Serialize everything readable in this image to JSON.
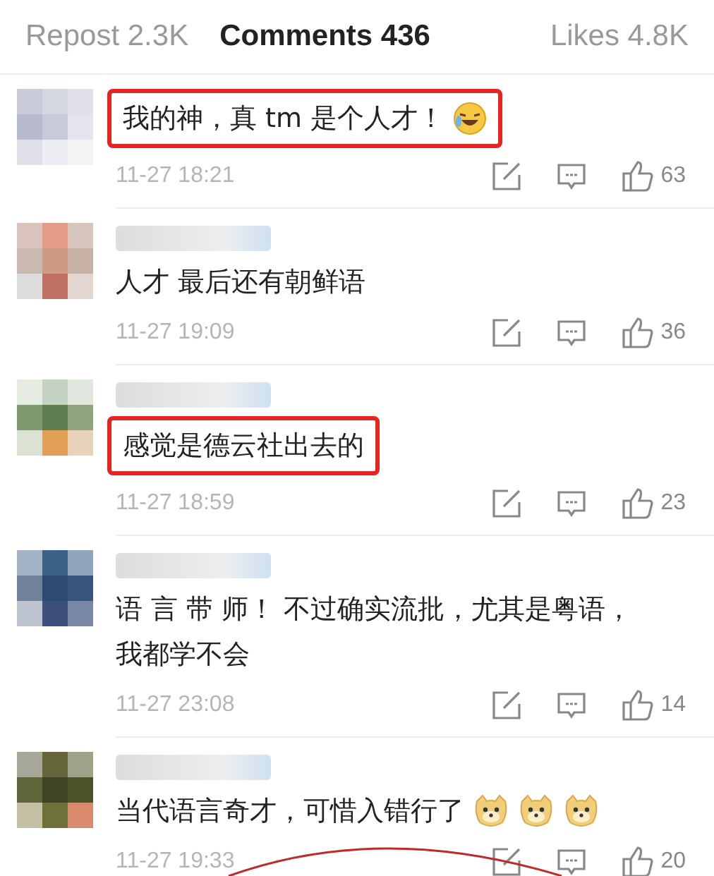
{
  "tabs": [
    {
      "label": "Repost 2.3K",
      "selected": false
    },
    {
      "label": "Comments 436",
      "selected": true
    },
    {
      "label": "Likes 4.8K",
      "selected": false
    }
  ],
  "comments": [
    {
      "name_shown": false,
      "text": "我的神，真 tm 是个人才！",
      "emojis": [
        {
          "kind": "laughing"
        }
      ],
      "time": "11-27 18:21",
      "likes": "63",
      "highlighted": true
    },
    {
      "name_shown": true,
      "text": "人才 最后还有朝鲜语",
      "time": "11-27 19:09",
      "likes": "36",
      "highlighted": false
    },
    {
      "name_shown": true,
      "text": "感觉是德云社出去的",
      "time": "11-27 18:59",
      "likes": "23",
      "highlighted": true
    },
    {
      "name_shown": true,
      "text": "语 言 带 师！ 不过确实流批，尤其是粤语，我都学不会",
      "time": "11-27 23:08",
      "likes": "14",
      "highlighted": false
    },
    {
      "name_shown": true,
      "text": "当代语言奇才，可惜入错行了",
      "emojis": [
        {
          "kind": "doge"
        },
        {
          "kind": "doge"
        },
        {
          "kind": "doge"
        }
      ],
      "time": "11-27 19:33",
      "likes": "20",
      "highlighted": false
    }
  ]
}
